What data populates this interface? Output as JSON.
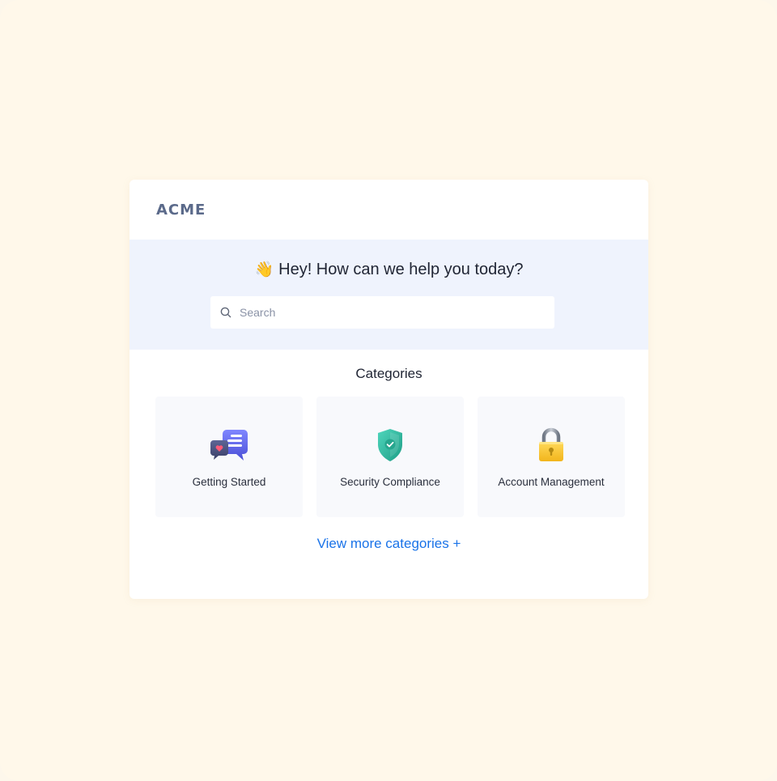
{
  "brand": {
    "logo_text": "ACME"
  },
  "hero": {
    "emoji": "👋",
    "greeting": "Hey! How can we help you today?",
    "search": {
      "placeholder": "Search",
      "value": ""
    }
  },
  "categories": {
    "title": "Categories",
    "items": [
      {
        "label": "Getting Started",
        "icon": "chat-bubbles-icon"
      },
      {
        "label": "Security Compliance",
        "icon": "shield-check-icon"
      },
      {
        "label": "Account Management",
        "icon": "padlock-icon"
      }
    ],
    "view_more_label": "View more categories +"
  },
  "colors": {
    "page_background": "#fff8ea",
    "hero_background": "#eff3fd",
    "link": "#1a73e8",
    "logo": "#5b6a8a"
  }
}
